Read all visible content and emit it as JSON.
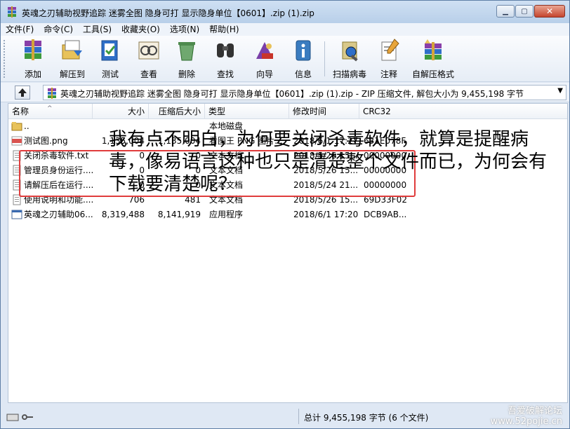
{
  "window": {
    "title": "英魂之刃辅助视野追踪 迷雾全图 隐身可打 显示隐身单位【0601】.zip (1).zip",
    "buttons": {
      "minimize": "▁",
      "maximize": "▢",
      "close": "✕"
    }
  },
  "menu": [
    "文件(F)",
    "命令(C)",
    "工具(S)",
    "收藏夹(O)",
    "选项(N)",
    "帮助(H)"
  ],
  "toolbar": [
    {
      "label": "添加",
      "icon": "add-archive-icon"
    },
    {
      "label": "解压到",
      "icon": "extract-to-icon"
    },
    {
      "label": "测试",
      "icon": "test-icon"
    },
    {
      "label": "查看",
      "icon": "view-icon"
    },
    {
      "label": "删除",
      "icon": "delete-icon"
    },
    {
      "label": "查找",
      "icon": "find-icon"
    },
    {
      "label": "向导",
      "icon": "wizard-icon"
    },
    {
      "label": "信息",
      "icon": "info-icon"
    },
    {
      "label": "扫描病毒",
      "icon": "virus-scan-icon"
    },
    {
      "label": "注释",
      "icon": "comment-icon"
    },
    {
      "label": "自解压格式",
      "icon": "sfx-icon"
    }
  ],
  "address": {
    "path": "英魂之刃辅助视野追踪 迷雾全图 隐身可打 显示隐身单位【0601】.zip (1).zip - ZIP 压缩文件, 解包大小为 9,455,198 字节"
  },
  "columns": [
    "名称",
    "大小",
    "压缩后大小",
    "类型",
    "修改时间",
    "CRC32"
  ],
  "files": [
    {
      "name": "..",
      "size": "",
      "packed": "",
      "type": "本地磁盘",
      "modified": "",
      "crc": "",
      "icon": "folder-up-icon"
    },
    {
      "name": "测试图.png",
      "size": "1,135,004",
      "packed": "1,135,004",
      "type": "看图王 PNG 图片...",
      "modified": "2018/6/1 17:27",
      "crc": "631E078F",
      "icon": "png-file-icon"
    },
    {
      "name": "关闭杀毒软件.txt",
      "size": "0",
      "packed": "0",
      "type": "文本文档",
      "modified": "2018/5/26 15...",
      "crc": "00000000",
      "icon": "text-file-icon"
    },
    {
      "name": "管理员身份运行....",
      "size": "0",
      "packed": "0",
      "type": "文本文档",
      "modified": "2018/5/26 15...",
      "crc": "00000000",
      "icon": "text-file-icon"
    },
    {
      "name": "请解压后在运行....",
      "size": "0",
      "packed": "0",
      "type": "文本文档",
      "modified": "2018/5/24 21...",
      "crc": "00000000",
      "icon": "text-file-icon"
    },
    {
      "name": "使用说明和功能....",
      "size": "706",
      "packed": "481",
      "type": "文本文档",
      "modified": "2018/5/26 15...",
      "crc": "69D33F02",
      "icon": "text-file-icon"
    },
    {
      "name": "英魂之刃辅助06....",
      "size": "8,319,488",
      "packed": "8,141,919",
      "type": "应用程序",
      "modified": "2018/6/1 17:20",
      "crc": "DCB9AB...",
      "icon": "exe-file-icon"
    }
  ],
  "note": "我有点不明白，为何要关闭杀毒软件，就算是提醒病毒，像易语言这种也只是清楚整个文件而已，为何会有下载要清楚呢？",
  "status": {
    "total": "总计 9,455,198 字节 (6 个文件)",
    "watermark_line1": "吾爱破解论坛",
    "watermark_line2": "www.52pojie.cn"
  }
}
